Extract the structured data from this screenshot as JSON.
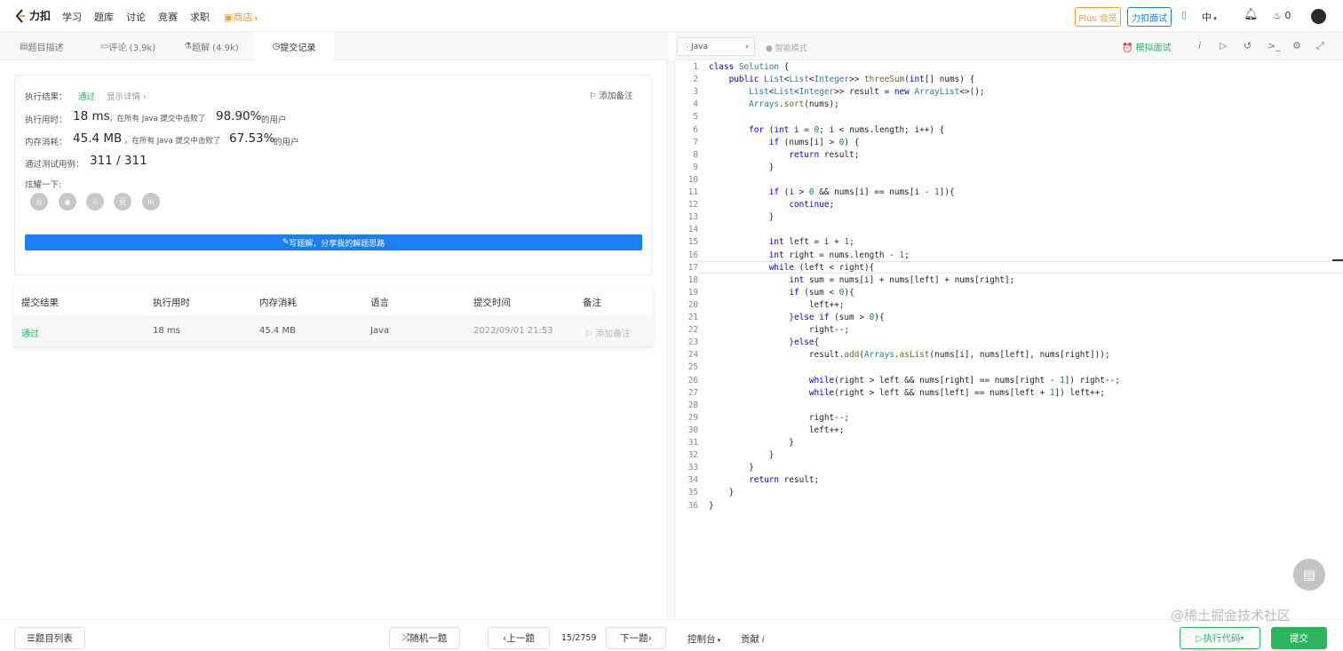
{
  "nav": {
    "logo": "力扣",
    "links": [
      "学习",
      "题库",
      "讨论",
      "竞赛",
      "求职"
    ],
    "shop": "商店",
    "plus": "Plus 会员",
    "interview": "力扣面试",
    "lang": "中",
    "points": "0"
  },
  "tabs": [
    {
      "label": "题目描述"
    },
    {
      "label": "评论 (3.9k)"
    },
    {
      "label": "题解 (4.9k)"
    },
    {
      "label": "提交记录"
    }
  ],
  "editor_bar": {
    "language": "Java",
    "smart_mode": "智能模式",
    "mock_interview": "模拟面试"
  },
  "result": {
    "result_label": "执行结果：",
    "result_value": "通过",
    "details_link": "显示详情 ›",
    "add_note": "添加备注",
    "time_label": "执行用时：",
    "time_value": "18 ms",
    "time_mid": "，在所有 Java 提交中击败了",
    "time_pct": "98.90%",
    "time_suffix": "的用户",
    "mem_label": "内存消耗：",
    "mem_value": "45.4 MB",
    "mem_mid": "，在所有 Java 提交中击败了",
    "mem_pct": "67.53%",
    "mem_suffix": "的用户",
    "cases_label": "通过测试用例：",
    "cases_value": "311 / 311",
    "share_label": "炫耀一下:",
    "write_button": "写题解，分享我的解题思路"
  },
  "table": {
    "headers": [
      "提交结果",
      "执行用时",
      "内存消耗",
      "语言",
      "提交时间",
      "备注"
    ],
    "row": {
      "status": "通过",
      "time": "18 ms",
      "memory": "45.4 MB",
      "language": "Java",
      "submitted": "2022/09/01 21:53",
      "note": "添加备注"
    }
  },
  "code_lines": [
    "class Solution {",
    "    public List<List<Integer>> threeSum(int[] nums) {",
    "        List<List<Integer>> result = new ArrayList<>();",
    "        Arrays.sort(nums);",
    "",
    "        for (int i = 0; i < nums.length; i++) {",
    "            if (nums[i] > 0) {",
    "                return result;",
    "            }",
    "",
    "            if (i > 0 && nums[i] == nums[i - 1]){",
    "                continue;",
    "            }",
    "",
    "            int left = i + 1;",
    "            int right = nums.length - 1;",
    "            while (left < right){",
    "                int sum = nums[i] + nums[left] + nums[right];",
    "                if (sum < 0){",
    "                    left++;",
    "                }else if (sum > 0){",
    "                    right--;",
    "                }else{",
    "                    result.add(Arrays.asList(nums[i], nums[left], nums[right]));",
    "",
    "                    while(right > left && nums[right] == nums[right - 1]) right--;",
    "                    while(right > left && nums[left] == nums[left + 1]) left++;",
    "",
    "                    right--;",
    "                    left++;",
    "                }",
    "            }",
    "        }",
    "        return result;",
    "    }",
    "}"
  ],
  "bottom": {
    "problem_list": "题目列表",
    "random": "随机一题",
    "prev": "上一题",
    "counter": "15/2759",
    "next": "下一题",
    "console": "控制台",
    "contribute": "贡献",
    "run": "执行代码",
    "submit": "提交"
  },
  "watermark": "@稀土掘金技术社区",
  "colors": {
    "accent": "#1a7ff0",
    "success": "#2db55d",
    "plus": "#f0a020"
  }
}
